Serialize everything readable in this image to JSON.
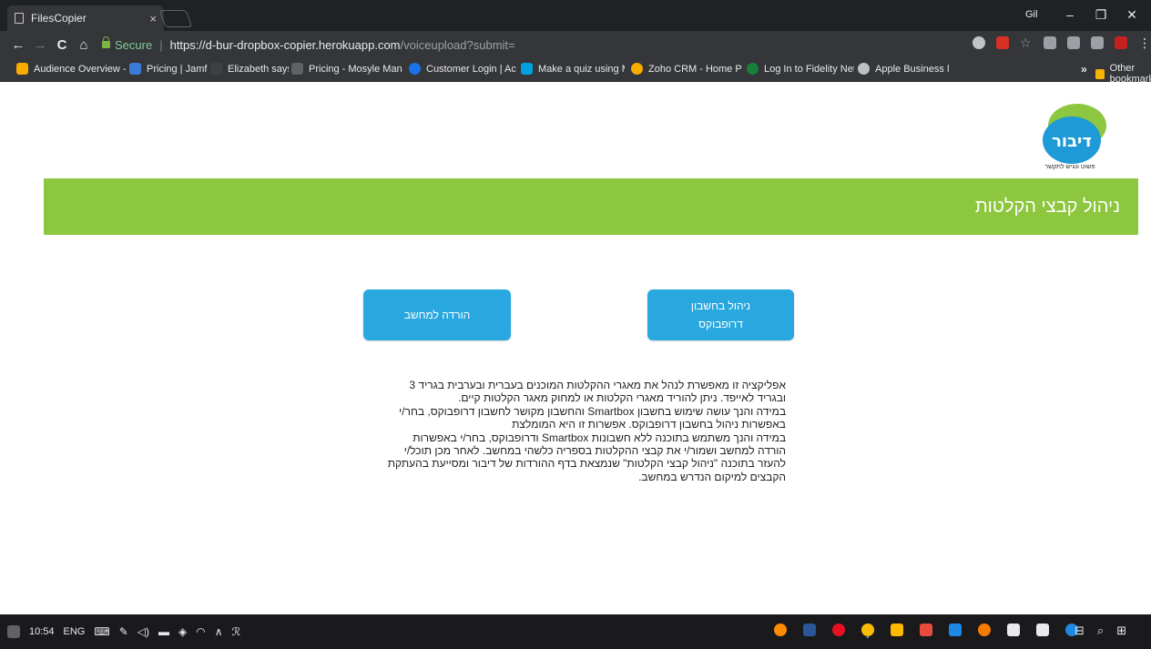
{
  "browser": {
    "tab_title": "FilesCopier",
    "tab_close": "×",
    "window_user": "Gil",
    "window_controls": {
      "minimize": "–",
      "maximize": "❐",
      "close": "✕"
    },
    "nav": {
      "back": "←",
      "forward": "→",
      "reload": "C",
      "home": "⌂"
    },
    "secure_label": "Secure",
    "url_host": "https://d-bur-dropbox-copier.herokuapp.com",
    "url_path": "/voiceupload?submit=",
    "bookmarks": [
      {
        "label": "Audience Overview -",
        "color": "#f9ab00"
      },
      {
        "label": "Pricing | Jamf",
        "color": "#3a7bd5"
      },
      {
        "label": "Elizabeth says...",
        "color": "#3c4043"
      },
      {
        "label": "Pricing - Mosyle Man",
        "color": "#5f6368"
      },
      {
        "label": "Customer Login | Act",
        "color": "#1a73e8"
      },
      {
        "label": "Make a quiz using M",
        "color": "#00a1e0"
      },
      {
        "label": "Zoho CRM - Home P",
        "color": "#f9ab00"
      },
      {
        "label": "Log In to Fidelity Net",
        "color": "#188038"
      },
      {
        "label": "Apple Business Manag",
        "color": "#bdc1c6"
      }
    ],
    "more_bookmarks": "»",
    "other_bookmarks": "Other bookmarks"
  },
  "page": {
    "logo_text": "דיבור",
    "logo_tagline": "פשוט ונגיש לתקשר",
    "banner_title": "ניהול קבצי הקלטות",
    "download_button": "הורדה למחשב",
    "dropbox_button": "ניהול בחשבון דרופבוקס",
    "description_lines": [
      "אפליקציה זו מאפשרת לנהל את מאגרי ההקלטות המוכנים בעברית ובערבית בגריד 3",
      "ובגריד לאייפד. ניתן להוריד מאגרי הקלטות או למחוק מאגר הקלטות קיים.",
      "במידה והנך עושה שימוש בחשבון Smartbox והחשבון מקושר לחשבון דרופבוקס, בחר/י",
      "באפשרות ניהול בחשבון דרופבוקס. אפשרות זו היא המומלצת",
      "במידה והנך משתמש בתוכנה ללא חשבונות Smartbox ודרופבוקס, בחר/י באפשרות",
      "הורדה למחשב ושמור/י את קבצי ההקלטות בספריה כלשהי במחשב. לאחר מכן תוכל/י",
      "להעזר בתוכנה \"ניהול קבצי הקלטות\" שנמצאת בדף ההורדות של דיבור ומסייעת בהעתקת",
      "הקבצים למיקום הנדרש במחשב."
    ],
    "colors": {
      "banner": "#8dc63f",
      "button": "#29a8e0",
      "logo_blue": "#1e9ad6",
      "logo_green": "#8dc63f"
    }
  },
  "taskbar": {
    "time": "10:54",
    "language": "ENG"
  }
}
